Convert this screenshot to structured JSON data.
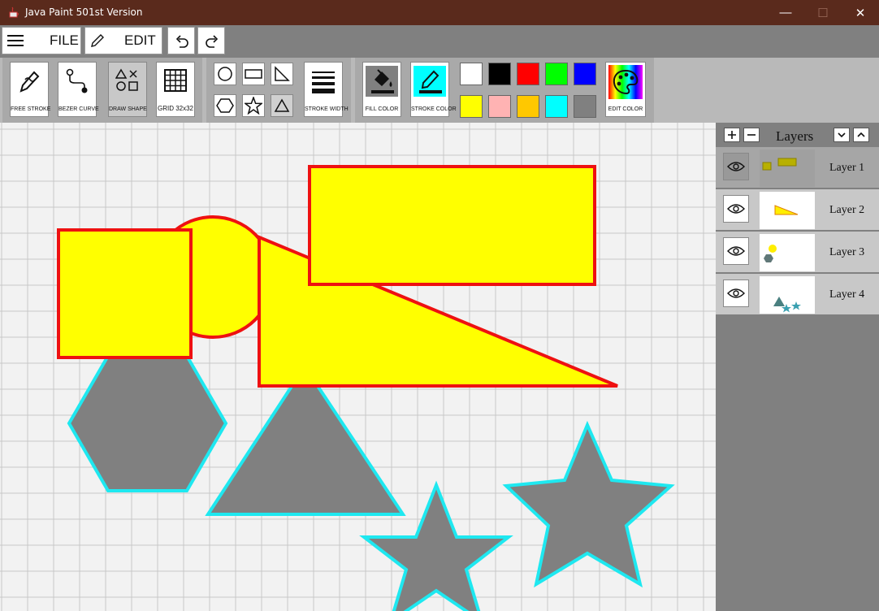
{
  "window": {
    "title": "Java Paint 501st Version",
    "minimize": "—",
    "maximize": "☐",
    "close": "✕"
  },
  "menu": {
    "file": "FILE",
    "edit": "EDIT"
  },
  "toolbar": {
    "free_stroke": "FREE STROKE",
    "bezier_curve": "BEZER CURVE",
    "draw_shape": "DRAW SHAPE",
    "grid": "GRID 32x32",
    "stroke_width": "STROKE WIDTH",
    "fill_color": "FILL COLOR",
    "stroke_color": "STROKE COLOR",
    "edit_color": "EDIT COLOR"
  },
  "palette": {
    "stroke_color_value": "#00ffff",
    "swatches": [
      "#ffffff",
      "#000000",
      "#ff0000",
      "#00ff00",
      "#0000ff",
      "#ffff00",
      "#ffb3b3",
      "#ffc800",
      "#00ffff",
      "#808080"
    ]
  },
  "canvas": {
    "grid_size": 32,
    "background": "#f2f2f2",
    "colors": {
      "yellow": "#ffff00",
      "red": "#ee1111",
      "gray": "#808080",
      "cyan": "#1ee8f0"
    }
  },
  "layers_panel": {
    "title": "Layers",
    "add": "+",
    "remove": "−",
    "layers": [
      {
        "name": "Layer 1",
        "selected": true
      },
      {
        "name": "Layer 2",
        "selected": false
      },
      {
        "name": "Layer 3",
        "selected": false
      },
      {
        "name": "Layer 4",
        "selected": false
      }
    ]
  }
}
